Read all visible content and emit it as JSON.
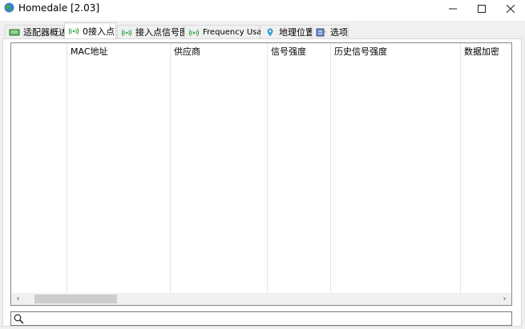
{
  "window": {
    "title": "Homedale [2.03]",
    "controls": {
      "minimize": "—",
      "maximize": "☐",
      "close": "✕"
    }
  },
  "tabs": [
    {
      "label": "适配器概述",
      "icon": "adapter-icon",
      "active": false
    },
    {
      "label": "0接入点",
      "icon": "wifi-signal-icon",
      "active": true
    },
    {
      "label": "接入点信号图",
      "icon": "wifi-signal-icon",
      "active": false
    },
    {
      "label": "Frequency Usage",
      "icon": "wifi-signal-icon",
      "active": false
    },
    {
      "label": "地理位置",
      "icon": "location-pin-icon",
      "active": false
    },
    {
      "label": "选项",
      "icon": "options-icon",
      "active": false
    }
  ],
  "table": {
    "columns": [
      "",
      "MAC地址",
      "供应商",
      "信号强度",
      "历史信号强度",
      "数据加密"
    ],
    "rows": []
  },
  "scrollbar": {
    "left_arrow": "‹",
    "right_arrow": "›"
  },
  "search": {
    "value": "",
    "placeholder": ""
  },
  "colors": {
    "accent": "#2a9d3a",
    "border": "#828790",
    "background": "#f0f0f0"
  }
}
